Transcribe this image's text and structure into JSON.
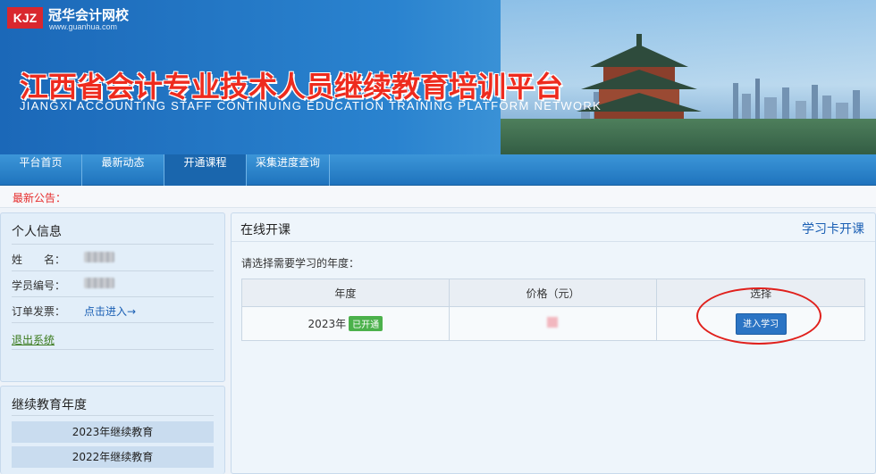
{
  "brand": {
    "logo_text": "KJZ",
    "name": "冠华会计网校",
    "url": "www.guanhua.com"
  },
  "banner": {
    "title": "江西省会计专业技术人员继续教育培训平台",
    "subtitle": "JIANGXI ACCOUNTING STAFF CONTINUING EDUCATION TRAINING PLATFORM NETWORK"
  },
  "nav": {
    "items": [
      {
        "label": "平台首页"
      },
      {
        "label": "最新动态"
      },
      {
        "label": "开通课程"
      },
      {
        "label": "采集进度查询"
      }
    ],
    "active_index": 2
  },
  "notice": {
    "label": "最新公告："
  },
  "personal_info": {
    "title": "个人信息",
    "name_label": "姓　　名：",
    "id_label": "学员编号：",
    "invoice_label": "订单发票：",
    "invoice_link": "点击进入→",
    "logout": "退出系统"
  },
  "years_panel": {
    "title": "继续教育年度",
    "years": [
      "2023年继续教育",
      "2022年继续教育"
    ]
  },
  "content": {
    "title": "在线开课",
    "card_link": "学习卡开课",
    "prompt": "请选择需要学习的年度：",
    "table": {
      "headers": [
        "年度",
        "价格（元）",
        "选择"
      ],
      "rows": [
        {
          "year": "2023年",
          "status": "已开通",
          "button": "进入学习"
        }
      ]
    }
  },
  "colors": {
    "accent": "#2b74c4",
    "title_red": "#ee2b1e",
    "status_green": "#4bb14b",
    "annotation_red": "#e0201c"
  }
}
